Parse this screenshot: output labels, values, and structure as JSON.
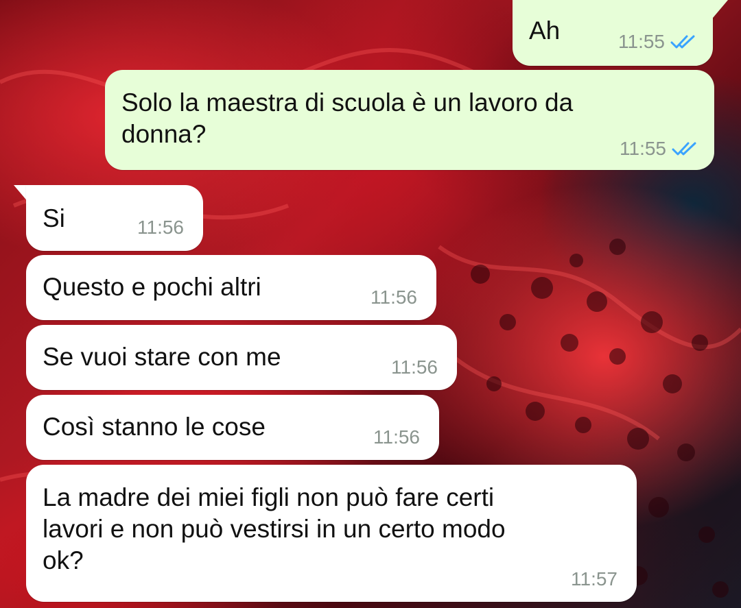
{
  "chat": {
    "messages": [
      {
        "direction": "outgoing",
        "text": "Ah",
        "time": "11:55",
        "status": "read-double-check-icon"
      },
      {
        "direction": "outgoing",
        "text": "Solo la maestra di scuola è un lavoro da\ndonna?",
        "time": "11:55",
        "status": "read-double-check-icon"
      },
      {
        "direction": "incoming",
        "text": "Si",
        "time": "11:56"
      },
      {
        "direction": "incoming",
        "text": "Questo e pochi altri",
        "time": "11:56"
      },
      {
        "direction": "incoming",
        "text": "Se vuoi stare con me",
        "time": "11:56"
      },
      {
        "direction": "incoming",
        "text": "Così stanno le cose",
        "time": "11:56"
      },
      {
        "direction": "incoming",
        "text": "La madre dei miei figli non può fare certi\nlavori e non può vestirsi in un certo modo\nok?",
        "time": "11:57"
      }
    ]
  },
  "colors": {
    "outgoing_bubble": "#e7fed8",
    "incoming_bubble": "#ffffff",
    "read_ticks": "#3aa3ff",
    "timestamp": "#8a948e"
  }
}
